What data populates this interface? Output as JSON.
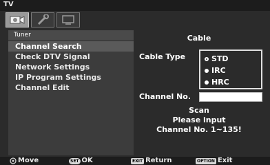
{
  "window": {
    "title": "TV"
  },
  "tabs": [
    {
      "name": "picture-tab",
      "icon": "tv-camera-icon",
      "active": true
    },
    {
      "name": "settings-tab",
      "icon": "wrench-icon",
      "active": false
    },
    {
      "name": "display-tab",
      "icon": "monitor-icon",
      "active": false
    }
  ],
  "sidebar": {
    "header": "Tuner",
    "items": [
      {
        "label": "Channel Search",
        "selected": true
      },
      {
        "label": "Check DTV Signal",
        "selected": false
      },
      {
        "label": "Network Settings",
        "selected": false
      },
      {
        "label": "IP Program Settings",
        "selected": false
      },
      {
        "label": "Channel Edit",
        "selected": false
      }
    ]
  },
  "panel": {
    "title": "Cable",
    "cable_type_label": "Cable Type",
    "cable_type_options": [
      {
        "label": "STD",
        "selected": true
      },
      {
        "label": "IRC",
        "selected": false
      },
      {
        "label": "HRC",
        "selected": false
      }
    ],
    "channel_no_label": "Channel No.",
    "channel_no_value": "",
    "message_lines": [
      "Scan",
      "Please input",
      "Channel No. 1~135!"
    ]
  },
  "footer": {
    "move": {
      "key": "",
      "label": "Move"
    },
    "ok": {
      "key": "SET",
      "label": "OK"
    },
    "return": {
      "key": "EXIT",
      "label": "Return"
    },
    "exit": {
      "key": "OPTION",
      "label": "Exit"
    }
  },
  "colors": {
    "background": "#2b2b2b",
    "panel": "#3c3c3c",
    "selection": "#5a5a5a",
    "text": "#ffffff"
  }
}
